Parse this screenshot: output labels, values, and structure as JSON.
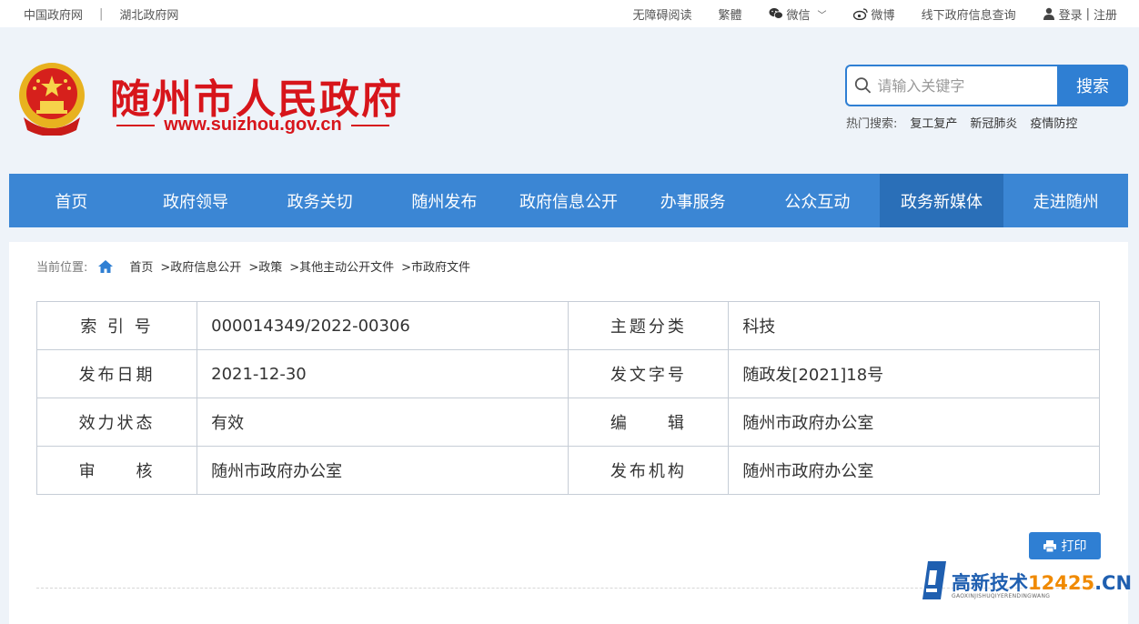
{
  "topbar": {
    "left_links": [
      "中国政府网",
      "湖北政府网"
    ],
    "separator": "|",
    "accessible": "无障碍阅读",
    "traditional": "繁體",
    "wechat": "微信",
    "weibo": "微博",
    "offline_query": "线下政府信息查询",
    "login": "登录",
    "login_sep": "|",
    "register": "注册"
  },
  "header": {
    "title": "随州市人民政府",
    "url": "www.suizhou.gov.cn"
  },
  "search": {
    "placeholder": "请输入关键字",
    "button": "搜索",
    "hot_label": "热门搜索:",
    "hot_items": [
      "复工复产",
      "新冠肺炎",
      "疫情防控"
    ]
  },
  "nav": {
    "items": [
      "首页",
      "政府领导",
      "政务关切",
      "随州发布",
      "政府信息公开",
      "办事服务",
      "公众互动",
      "政务新媒体",
      "走进随州"
    ],
    "active_index": 7
  },
  "breadcrumb": {
    "label": "当前位置:",
    "items": [
      "首页",
      ">政府信息公开",
      ">政策",
      ">其他主动公开文件",
      ">市政府文件"
    ]
  },
  "meta_table": {
    "rows": [
      {
        "k1": "索 引 号",
        "v1": "000014349/2022-00306",
        "k2": "主题分类",
        "v2": "科技"
      },
      {
        "k1": "发布日期",
        "v1": "2021-12-30",
        "k2": "发文字号",
        "v2": "随政发[2021]18号"
      },
      {
        "k1": "效力状态",
        "v1": "有效",
        "k2": "编　　辑",
        "v2": "随州市政府办公室"
      },
      {
        "k1": "审　　核",
        "v1": "随州市政府办公室",
        "k2": "发布机构",
        "v2": "随州市政府办公室"
      }
    ]
  },
  "print_button": "打印",
  "watermark": {
    "main": "高新技术",
    "num": "12425",
    "tld": ".CN",
    "sub": "GAOXINJISHUQIYERENDINGWANG"
  },
  "colors": {
    "brand_red": "#d7151b",
    "nav_blue": "#3b86d4",
    "nav_active": "#2a6fb8",
    "button_blue": "#2f7fd3"
  }
}
